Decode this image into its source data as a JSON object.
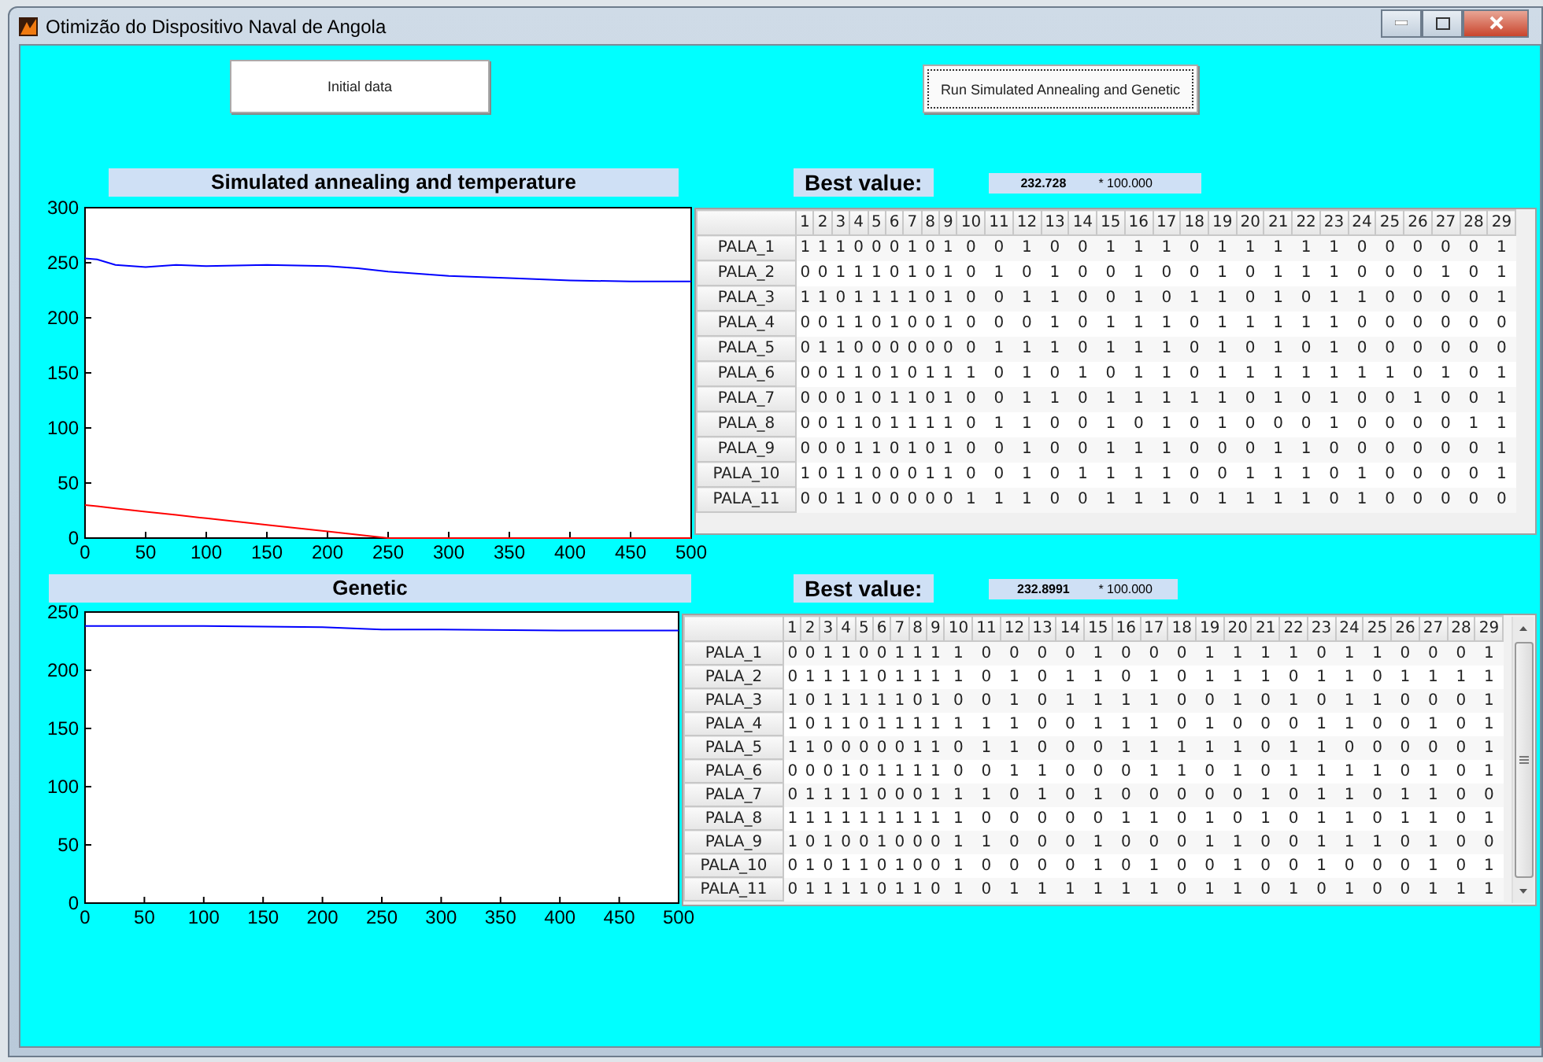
{
  "window": {
    "title": "Otimizão do Dispositivo Naval de Angola"
  },
  "buttons": [
    {
      "label": "Initial data",
      "focused": false
    },
    {
      "label": "Run Simulated Annealing and Genetic",
      "focused": true
    }
  ],
  "panels": [
    {
      "title": "Simulated annealing and temperature",
      "best_label": "Best value:",
      "best_value": "232.728",
      "multiplier": "* 100.000",
      "scrollable": false,
      "chart_data": {
        "type": "line",
        "x": [
          0,
          10,
          25,
          50,
          75,
          100,
          150,
          200,
          225,
          250,
          300,
          350,
          400,
          450,
          500
        ],
        "xlim": [
          0,
          500
        ],
        "ylim": [
          0,
          300
        ],
        "xticks": [
          0,
          50,
          100,
          150,
          200,
          250,
          300,
          350,
          400,
          450,
          500
        ],
        "yticks": [
          0,
          50,
          100,
          150,
          200,
          250,
          300
        ],
        "series": [
          {
            "color": "#0000ff",
            "values": [
              254,
              253,
              248,
              246,
              248,
              247,
              248,
              247,
              245,
              242,
              238,
              236,
              234,
              233,
              233
            ]
          },
          {
            "color": "#ff0000",
            "values": [
              30,
              29,
              27,
              24,
              21,
              18,
              12,
              6,
              3,
              0,
              0,
              0,
              0,
              0,
              0
            ]
          }
        ]
      },
      "table": {
        "columns": [
          "1",
          "2",
          "3",
          "4",
          "5",
          "6",
          "7",
          "8",
          "9",
          "10",
          "11",
          "12",
          "13",
          "14",
          "15",
          "16",
          "17",
          "18",
          "19",
          "20",
          "21",
          "22",
          "23",
          "24",
          "25",
          "26",
          "27",
          "28",
          "29"
        ],
        "rows": [
          {
            "label": "PALA_1",
            "cells": [
              "1",
              "1",
              "1",
              "0",
              "0",
              "0",
              "1",
              "0",
              "1",
              "0",
              "0",
              "1",
              "0",
              "0",
              "1",
              "1",
              "1",
              "0",
              "1",
              "1",
              "1",
              "1",
              "1",
              "0",
              "0",
              "0",
              "0",
              "0",
              "1"
            ]
          },
          {
            "label": "PALA_2",
            "cells": [
              "0",
              "0",
              "1",
              "1",
              "1",
              "0",
              "1",
              "0",
              "1",
              "0",
              "1",
              "0",
              "1",
              "0",
              "0",
              "1",
              "0",
              "0",
              "1",
              "0",
              "1",
              "1",
              "1",
              "0",
              "0",
              "0",
              "1",
              "0",
              "1"
            ]
          },
          {
            "label": "PALA_3",
            "cells": [
              "1",
              "1",
              "0",
              "1",
              "1",
              "1",
              "1",
              "0",
              "1",
              "0",
              "0",
              "1",
              "1",
              "0",
              "0",
              "1",
              "0",
              "1",
              "1",
              "0",
              "1",
              "0",
              "1",
              "1",
              "0",
              "0",
              "0",
              "0",
              "1"
            ]
          },
          {
            "label": "PALA_4",
            "cells": [
              "0",
              "0",
              "1",
              "1",
              "0",
              "1",
              "0",
              "0",
              "1",
              "0",
              "0",
              "0",
              "1",
              "0",
              "1",
              "1",
              "1",
              "0",
              "1",
              "1",
              "1",
              "1",
              "1",
              "0",
              "0",
              "0",
              "0",
              "0",
              "0"
            ]
          },
          {
            "label": "PALA_5",
            "cells": [
              "0",
              "1",
              "1",
              "0",
              "0",
              "0",
              "0",
              "0",
              "0",
              "0",
              "1",
              "1",
              "1",
              "0",
              "1",
              "1",
              "1",
              "0",
              "1",
              "0",
              "1",
              "0",
              "1",
              "0",
              "0",
              "0",
              "0",
              "0",
              "0"
            ]
          },
          {
            "label": "PALA_6",
            "cells": [
              "0",
              "0",
              "1",
              "1",
              "0",
              "1",
              "0",
              "1",
              "1",
              "1",
              "0",
              "1",
              "0",
              "1",
              "0",
              "1",
              "1",
              "0",
              "1",
              "1",
              "1",
              "1",
              "1",
              "1",
              "1",
              "0",
              "1",
              "0",
              "1"
            ]
          },
          {
            "label": "PALA_7",
            "cells": [
              "0",
              "0",
              "0",
              "1",
              "0",
              "1",
              "1",
              "0",
              "1",
              "0",
              "0",
              "1",
              "1",
              "0",
              "1",
              "1",
              "1",
              "1",
              "1",
              "0",
              "1",
              "0",
              "1",
              "0",
              "0",
              "1",
              "0",
              "0",
              "1"
            ]
          },
          {
            "label": "PALA_8",
            "cells": [
              "0",
              "0",
              "1",
              "1",
              "0",
              "1",
              "1",
              "1",
              "1",
              "0",
              "1",
              "1",
              "0",
              "0",
              "1",
              "0",
              "1",
              "0",
              "1",
              "0",
              "0",
              "0",
              "1",
              "0",
              "0",
              "0",
              "0",
              "1",
              "1"
            ]
          },
          {
            "label": "PALA_9",
            "cells": [
              "0",
              "0",
              "0",
              "1",
              "1",
              "0",
              "1",
              "0",
              "1",
              "0",
              "0",
              "1",
              "0",
              "0",
              "1",
              "1",
              "1",
              "0",
              "0",
              "0",
              "1",
              "1",
              "0",
              "0",
              "0",
              "0",
              "0",
              "0",
              "1"
            ]
          },
          {
            "label": "PALA_10",
            "cells": [
              "1",
              "0",
              "1",
              "1",
              "0",
              "0",
              "0",
              "1",
              "1",
              "0",
              "0",
              "1",
              "0",
              "1",
              "1",
              "1",
              "1",
              "0",
              "0",
              "1",
              "1",
              "1",
              "0",
              "1",
              "0",
              "0",
              "0",
              "0",
              "1"
            ]
          },
          {
            "label": "PALA_11",
            "cells": [
              "0",
              "0",
              "1",
              "1",
              "0",
              "0",
              "0",
              "0",
              "0",
              "1",
              "1",
              "1",
              "0",
              "0",
              "1",
              "1",
              "1",
              "0",
              "1",
              "1",
              "1",
              "1",
              "0",
              "1",
              "0",
              "0",
              "0",
              "0",
              "0"
            ]
          }
        ]
      }
    },
    {
      "title": "Genetic",
      "best_label": "Best value:",
      "best_value": "232.8991",
      "multiplier": "* 100.000",
      "scrollable": true,
      "chart_data": {
        "type": "line",
        "x": [
          0,
          100,
          200,
          250,
          300,
          400,
          500
        ],
        "xlim": [
          0,
          500
        ],
        "ylim": [
          0,
          250
        ],
        "xticks": [
          0,
          50,
          100,
          150,
          200,
          250,
          300,
          350,
          400,
          450,
          500
        ],
        "yticks": [
          0,
          50,
          100,
          150,
          200,
          250
        ],
        "series": [
          {
            "color": "#0000ff",
            "values": [
              238,
              238,
              237,
              235,
              235,
              234,
              234
            ]
          }
        ]
      },
      "table": {
        "columns": [
          "1",
          "2",
          "3",
          "4",
          "5",
          "6",
          "7",
          "8",
          "9",
          "10",
          "11",
          "12",
          "13",
          "14",
          "15",
          "16",
          "17",
          "18",
          "19",
          "20",
          "21",
          "22",
          "23",
          "24",
          "25",
          "26",
          "27",
          "28",
          "29"
        ],
        "rows": [
          {
            "label": "PALA_1",
            "cells": [
              "0",
              "0",
              "1",
              "1",
              "0",
              "0",
              "1",
              "1",
              "1",
              "1",
              "0",
              "0",
              "0",
              "0",
              "1",
              "0",
              "0",
              "0",
              "1",
              "1",
              "1",
              "1",
              "0",
              "1",
              "1",
              "0",
              "0",
              "0",
              "1"
            ]
          },
          {
            "label": "PALA_2",
            "cells": [
              "0",
              "1",
              "1",
              "1",
              "1",
              "0",
              "1",
              "1",
              "1",
              "1",
              "0",
              "1",
              "0",
              "1",
              "1",
              "0",
              "1",
              "0",
              "1",
              "1",
              "1",
              "0",
              "1",
              "1",
              "0",
              "1",
              "1",
              "1",
              "1"
            ]
          },
          {
            "label": "PALA_3",
            "cells": [
              "1",
              "0",
              "1",
              "1",
              "1",
              "1",
              "1",
              "0",
              "1",
              "0",
              "0",
              "1",
              "0",
              "1",
              "1",
              "1",
              "1",
              "0",
              "0",
              "1",
              "0",
              "1",
              "0",
              "1",
              "1",
              "0",
              "0",
              "0",
              "1"
            ]
          },
          {
            "label": "PALA_4",
            "cells": [
              "1",
              "0",
              "1",
              "1",
              "0",
              "1",
              "1",
              "1",
              "1",
              "1",
              "1",
              "1",
              "0",
              "0",
              "1",
              "1",
              "1",
              "0",
              "1",
              "0",
              "0",
              "0",
              "1",
              "1",
              "0",
              "0",
              "1",
              "0",
              "1"
            ]
          },
          {
            "label": "PALA_5",
            "cells": [
              "1",
              "1",
              "0",
              "0",
              "0",
              "0",
              "0",
              "1",
              "1",
              "0",
              "1",
              "1",
              "0",
              "0",
              "0",
              "1",
              "1",
              "1",
              "1",
              "1",
              "0",
              "1",
              "1",
              "0",
              "0",
              "0",
              "0",
              "0",
              "1"
            ]
          },
          {
            "label": "PALA_6",
            "cells": [
              "0",
              "0",
              "0",
              "1",
              "0",
              "1",
              "1",
              "1",
              "1",
              "0",
              "0",
              "1",
              "1",
              "0",
              "0",
              "0",
              "1",
              "1",
              "0",
              "1",
              "0",
              "1",
              "1",
              "1",
              "1",
              "0",
              "1",
              "0",
              "1"
            ]
          },
          {
            "label": "PALA_7",
            "cells": [
              "0",
              "1",
              "1",
              "1",
              "1",
              "0",
              "0",
              "0",
              "1",
              "1",
              "1",
              "0",
              "1",
              "0",
              "1",
              "0",
              "0",
              "0",
              "0",
              "0",
              "1",
              "0",
              "1",
              "1",
              "0",
              "1",
              "1",
              "0",
              "0"
            ]
          },
          {
            "label": "PALA_8",
            "cells": [
              "1",
              "1",
              "1",
              "1",
              "1",
              "1",
              "1",
              "1",
              "1",
              "1",
              "0",
              "0",
              "0",
              "0",
              "0",
              "1",
              "1",
              "0",
              "1",
              "0",
              "1",
              "0",
              "1",
              "1",
              "0",
              "1",
              "1",
              "0",
              "1"
            ]
          },
          {
            "label": "PALA_9",
            "cells": [
              "1",
              "0",
              "1",
              "0",
              "0",
              "1",
              "0",
              "0",
              "0",
              "1",
              "1",
              "0",
              "0",
              "0",
              "1",
              "0",
              "0",
              "0",
              "1",
              "1",
              "0",
              "0",
              "1",
              "1",
              "1",
              "0",
              "1",
              "0",
              "0"
            ]
          },
          {
            "label": "PALA_10",
            "cells": [
              "0",
              "1",
              "0",
              "1",
              "1",
              "0",
              "1",
              "0",
              "0",
              "1",
              "0",
              "0",
              "0",
              "0",
              "1",
              "0",
              "1",
              "0",
              "0",
              "1",
              "0",
              "0",
              "1",
              "0",
              "0",
              "0",
              "1",
              "0",
              "1"
            ]
          },
          {
            "label": "PALA_11",
            "cells": [
              "0",
              "1",
              "1",
              "1",
              "1",
              "0",
              "1",
              "1",
              "0",
              "1",
              "0",
              "1",
              "1",
              "1",
              "1",
              "1",
              "1",
              "0",
              "1",
              "1",
              "0",
              "1",
              "0",
              "1",
              "0",
              "0",
              "1",
              "1",
              "1"
            ]
          }
        ]
      }
    }
  ]
}
